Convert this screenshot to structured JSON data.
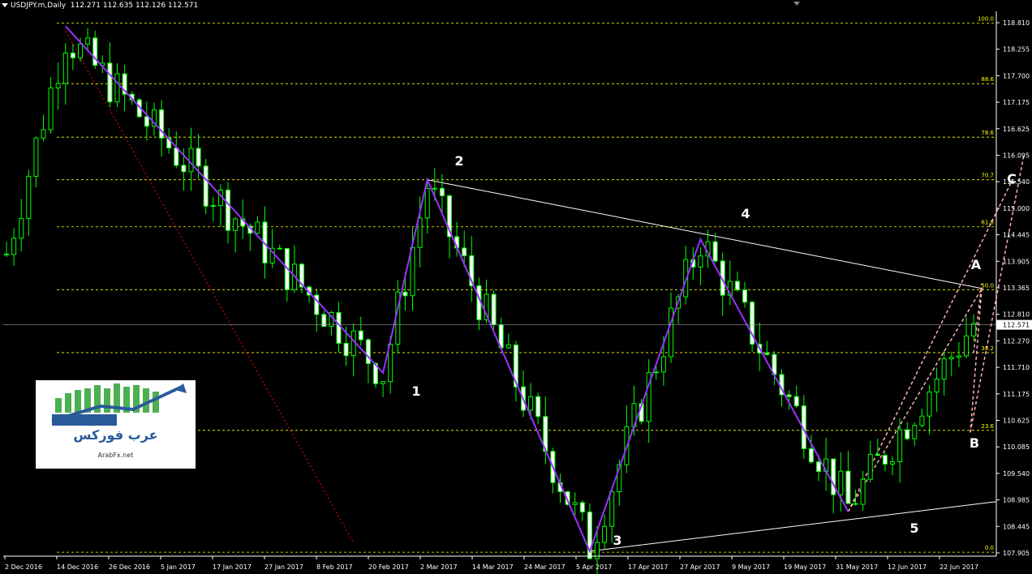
{
  "window": {
    "title": "USDJPY.m,Daily",
    "ohlc": "112.271 112.635 112.126 112.571"
  },
  "price_scale": [
    "118.810",
    "118.255",
    "117.700",
    "117.175",
    "116.625",
    "116.095",
    "115.540",
    "115.000",
    "114.445",
    "113.905",
    "113.365",
    "112.810",
    "112.270",
    "111.710",
    "111.175",
    "110.625",
    "110.085",
    "109.540",
    "108.985",
    "108.445",
    "107.905"
  ],
  "current_price": "112.571",
  "time_scale": [
    "2 Dec 2016",
    "14 Dec 2016",
    "26 Dec 2016",
    "5 Jan 2017",
    "17 Jan 2017",
    "27 Jan 2017",
    "8 Feb 2017",
    "20 Feb 2017",
    "2 Mar 2017",
    "14 Mar 2017",
    "24 Mar 2017",
    "5 Apr 2017",
    "17 Apr 2017",
    "27 Apr 2017",
    "9 May 2017",
    "19 May 2017",
    "31 May 2017",
    "12 Jun 2017",
    "22 Jun 2017"
  ],
  "fib_levels": [
    "100.0",
    "88.6",
    "78.6",
    "70.7",
    "61.8",
    "50.0",
    "38.2",
    "23.6",
    "0.0"
  ],
  "wave_labels": [
    "1",
    "2",
    "3",
    "4",
    "5",
    "A",
    "B",
    "C"
  ],
  "logo": {
    "brand_text": "عرب فوركس",
    "site": "ArabFx.net"
  },
  "colors": {
    "background": "#000000",
    "candle_up": "#00ff00",
    "candle_down": "#ffffff",
    "wave_line": "#9b30ff",
    "trendline": "#ffffff",
    "fib_line": "#ffff00",
    "projection": "#ffb0b0",
    "red_trend": "#ff0000"
  },
  "chart_data": {
    "type": "candlestick",
    "symbol": "USDJPY.m",
    "timeframe": "Daily",
    "ylim": [
      107.9,
      118.9
    ],
    "last_price": 112.571,
    "fibonacci": [
      {
        "label": "100.0",
        "price": 118.66
      },
      {
        "label": "88.6",
        "price": 117.44
      },
      {
        "label": "78.6",
        "price": 116.36
      },
      {
        "label": "70.7",
        "price": 115.5
      },
      {
        "label": "61.8",
        "price": 114.55
      },
      {
        "label": "50.0",
        "price": 113.28
      },
      {
        "label": "38.2",
        "price": 112.01
      },
      {
        "label": "23.6",
        "price": 110.44
      },
      {
        "label": "0.0",
        "price": 107.98
      }
    ],
    "waves": [
      {
        "label": "1",
        "bar": 51,
        "price": 111.6
      },
      {
        "label": "2",
        "bar": 57,
        "price": 115.5
      },
      {
        "label": "3",
        "bar": 79,
        "price": 108.0
      },
      {
        "label": "4",
        "bar": 94,
        "price": 114.3
      },
      {
        "label": "5",
        "bar": 114,
        "price": 108.8
      },
      {
        "label": "A",
        "bar": 124,
        "price": 113.3
      },
      {
        "label": "B",
        "bar": 123,
        "price": 110.2
      },
      {
        "label": "C",
        "bar": 130,
        "price": 115.9
      }
    ]
  }
}
